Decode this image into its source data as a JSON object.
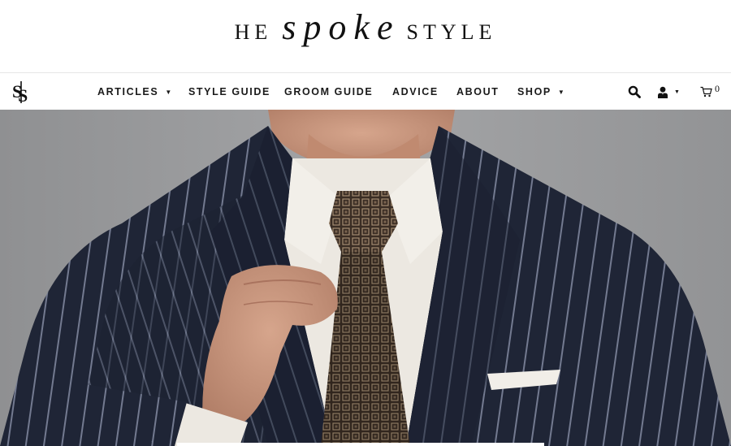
{
  "site": {
    "logo": {
      "pre": "HE",
      "script": "spoke",
      "post": "STYLE"
    }
  },
  "nav": {
    "monogram_icon": "monogram-logo-icon",
    "items": [
      {
        "label": "ARTICLES",
        "has_dropdown": true
      },
      {
        "label": "STYLE GUIDE",
        "has_dropdown": false
      },
      {
        "label": "GROOM GUIDE",
        "has_dropdown": false
      },
      {
        "label": "ADVICE",
        "has_dropdown": false
      },
      {
        "label": "ABOUT",
        "has_dropdown": false
      },
      {
        "label": "SHOP",
        "has_dropdown": true
      }
    ],
    "caret_glyph": "▼",
    "tools": {
      "search_icon": "search-icon",
      "account_icon": "user-icon",
      "cart_icon": "cart-icon",
      "cart_count": "0"
    }
  },
  "hero": {
    "image": "man-in-navy-pinstripe-suit-adjusting-brown-tie",
    "colors": {
      "backdrop": "#9a9b9d",
      "suit": "#1f2536",
      "pinstripe": "#8e96ad",
      "shirt": "#eeeae4",
      "tie": "#3e3027",
      "skin": "#c8947a"
    }
  }
}
